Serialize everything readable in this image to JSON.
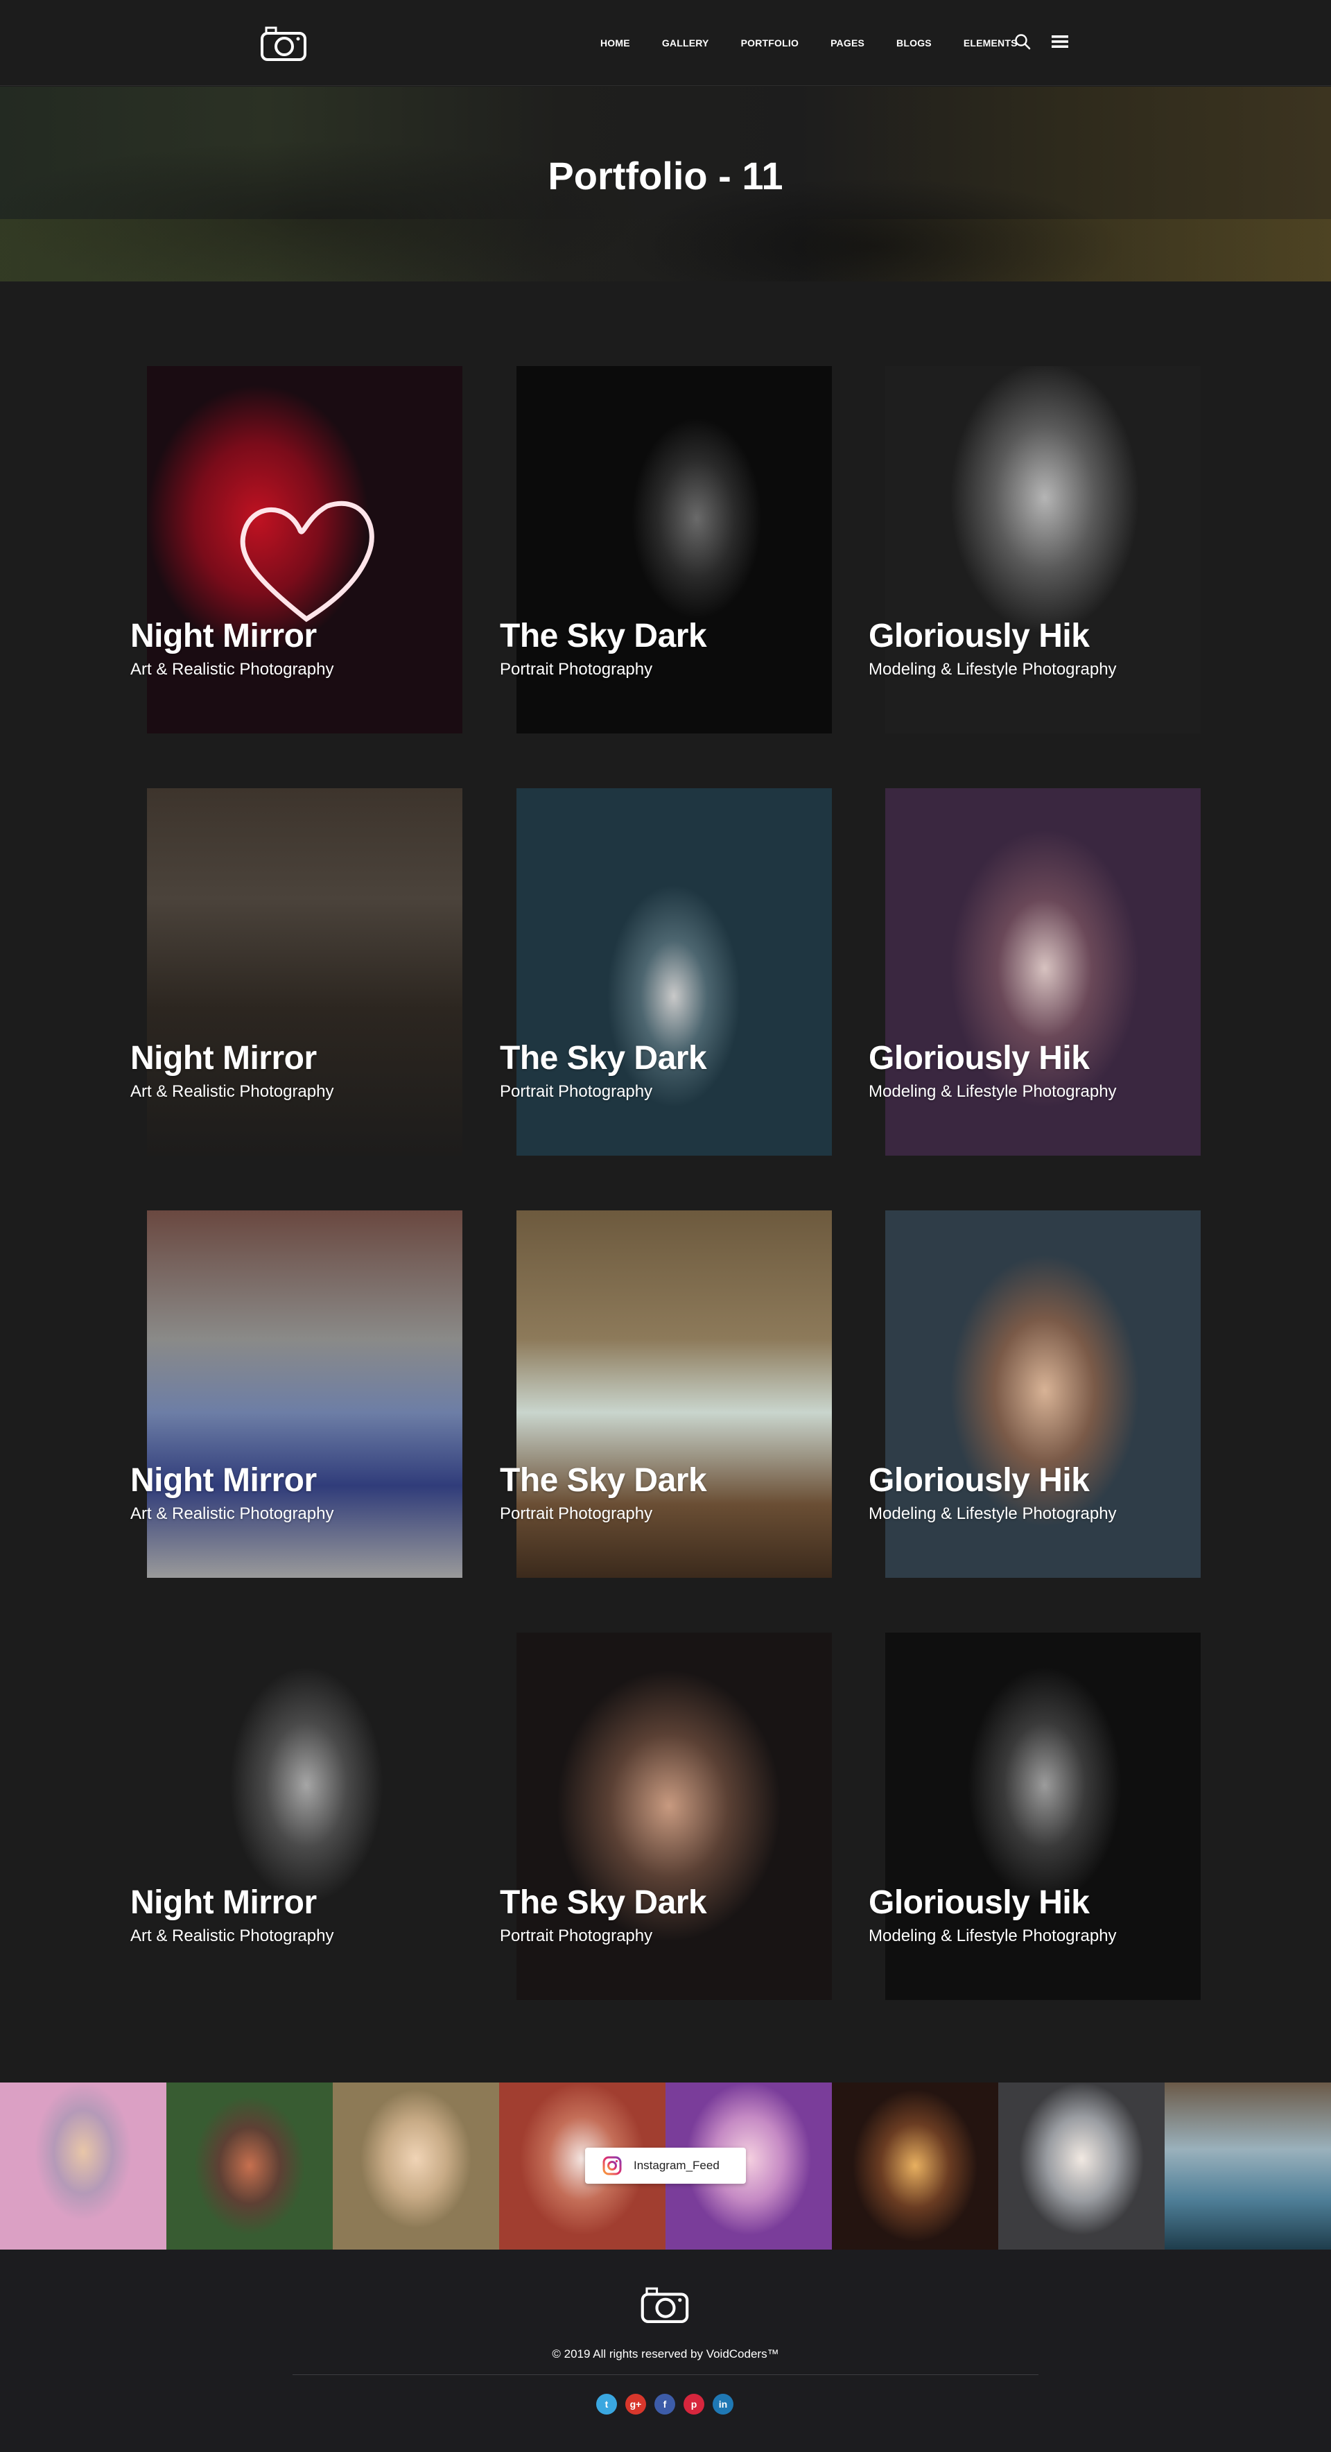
{
  "header": {
    "logo": "camera-logo",
    "nav": [
      "HOME",
      "GALLERY",
      "PORTFOLIO",
      "PAGES",
      "BLOGS",
      "ELEMENTS"
    ],
    "icons": [
      "search-icon",
      "menu-icon"
    ]
  },
  "banner": {
    "title": "Portfolio - 11"
  },
  "portfolio": {
    "items": [
      {
        "title": "Night Mirror",
        "subtitle": "Art & Realistic Photography"
      },
      {
        "title": "The Sky Dark",
        "subtitle": "Portrait Photography"
      },
      {
        "title": "Gloriously Hik",
        "subtitle": "Modeling & Lifestyle Photography"
      },
      {
        "title": "Night Mirror",
        "subtitle": "Art & Realistic Photography"
      },
      {
        "title": "The Sky Dark",
        "subtitle": "Portrait Photography"
      },
      {
        "title": "Gloriously Hik",
        "subtitle": "Modeling & Lifestyle Photography"
      },
      {
        "title": "Night Mirror",
        "subtitle": "Art & Realistic Photography"
      },
      {
        "title": "The Sky Dark",
        "subtitle": "Portrait Photography"
      },
      {
        "title": "Gloriously Hik",
        "subtitle": "Modeling & Lifestyle Photography"
      },
      {
        "title": "Night Mirror",
        "subtitle": "Art & Realistic Photography"
      },
      {
        "title": "The Sky Dark",
        "subtitle": "Portrait Photography"
      },
      {
        "title": "Gloriously Hik",
        "subtitle": "Modeling & Lifestyle Photography"
      }
    ]
  },
  "instagram": {
    "label": "Instagram_Feed",
    "icon": "instagram-icon"
  },
  "footer": {
    "logo": "camera-logo",
    "copyright": "© 2019 All rights reserved by VoidCoders™",
    "social": [
      {
        "name": "twitter-icon",
        "glyph": "t",
        "color": "#3aa7e0"
      },
      {
        "name": "google-plus-icon",
        "glyph": "g+",
        "color": "#d8372c"
      },
      {
        "name": "facebook-icon",
        "glyph": "f",
        "color": "#3d5ca8"
      },
      {
        "name": "pinterest-icon",
        "glyph": "p",
        "color": "#d7263d"
      },
      {
        "name": "linkedin-icon",
        "glyph": "in",
        "color": "#1f78b4"
      }
    ]
  },
  "colors": {
    "background": "#1c1c1c",
    "footer": "#1c1c1f",
    "text": "#ffffff"
  }
}
